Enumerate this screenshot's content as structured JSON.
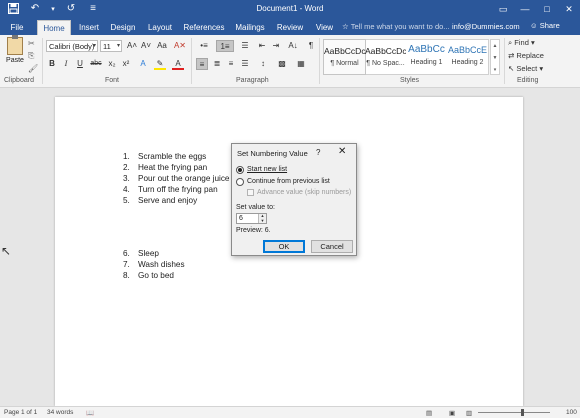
{
  "window": {
    "title": "Document1 - Word"
  },
  "qat": {
    "save_icon": "save-icon",
    "undo": "↶",
    "undo_dd": "▾",
    "redo": "↺",
    "customize": "≡"
  },
  "winctl": {
    "ribbon_opts": "▭",
    "minimize": "—",
    "maximize": "□",
    "close": "✕"
  },
  "tabs": [
    {
      "label": "File"
    },
    {
      "label": "Home"
    },
    {
      "label": "Insert"
    },
    {
      "label": "Design"
    },
    {
      "label": "Layout"
    },
    {
      "label": "References"
    },
    {
      "label": "Mailings"
    },
    {
      "label": "Review"
    },
    {
      "label": "View"
    }
  ],
  "tellme": {
    "text": "Tell me what you want to do..."
  },
  "account": {
    "email": "info@Dummies.com"
  },
  "share": {
    "label": "Share"
  },
  "ribbon": {
    "clipboard": {
      "paste": "Paste",
      "group": "Clipboard",
      "cut": "✂",
      "copy": "⎘",
      "painter": "🖌"
    },
    "font": {
      "group": "Font",
      "name": "Calibri (Body)",
      "size": "11",
      "grow": "A˄",
      "shrink": "A˅",
      "case": "Aa",
      "clear": "A✕",
      "bold": "B",
      "italic": "I",
      "underline": "U",
      "strike": "abc",
      "sub": "x₂",
      "sup": "x²",
      "effects": "A",
      "highlight": "✎",
      "color": "A"
    },
    "paragraph": {
      "group": "Paragraph",
      "bullets": "•≡",
      "numbering": "1≡",
      "multilevel": "☰",
      "decrease": "⇤",
      "increase": "⇥",
      "sort": "A↓",
      "pilcrow": "¶",
      "align_left": "≡",
      "center": "≣",
      "align_right": "≡",
      "justify": "☰",
      "spacing": "↕",
      "shading": "▩",
      "borders": "▦"
    },
    "styles": {
      "group": "Styles",
      "items": [
        {
          "preview": "AaBbCcDc",
          "name": "¶ Normal"
        },
        {
          "preview": "AaBbCcDc",
          "name": "¶ No Spac..."
        },
        {
          "preview": "AaBbCc",
          "name": "Heading 1"
        },
        {
          "preview": "AaBbCcE",
          "name": "Heading 2"
        }
      ],
      "scroll_up": "▲",
      "scroll_down": "▼",
      "more": "▾"
    },
    "editing": {
      "group": "Editing",
      "find": "Find",
      "replace": "Replace",
      "select": "Select"
    }
  },
  "document": {
    "list_a": [
      {
        "num": "1.",
        "text": "Scramble the eggs"
      },
      {
        "num": "2.",
        "text": "Heat the frying pan"
      },
      {
        "num": "3.",
        "text": "Pour out the orange juice"
      },
      {
        "num": "4.",
        "text": "Turn off the frying pan"
      },
      {
        "num": "5.",
        "text": "Serve and enjoy"
      }
    ],
    "list_b": [
      {
        "num": "6.",
        "text": "Sleep"
      },
      {
        "num": "7.",
        "text": "Wash dishes"
      },
      {
        "num": "8.",
        "text": "Go to bed"
      }
    ]
  },
  "dialog": {
    "title": "Set Numbering Value",
    "help": "?",
    "close": "✕",
    "start_new": "Start new list",
    "continue": "Continue from previous list",
    "advance": "Advance value (skip numbers)",
    "set_label": "Set value to:",
    "value": "6",
    "spin_up": "▲",
    "spin_down": "▼",
    "preview": "Preview: 6.",
    "ok": "OK",
    "cancel": "Cancel"
  },
  "status": {
    "page": "Page 1 of 1",
    "words": "34 words",
    "zoom": "100"
  }
}
